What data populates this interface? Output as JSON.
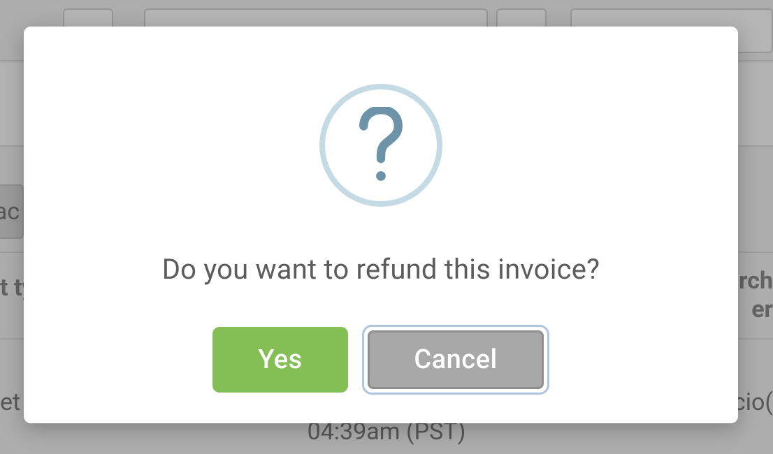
{
  "background": {
    "tab_fragment": "ac",
    "col_left_fragment": "t ty",
    "col_right_fragment_line1": "urch",
    "col_right_fragment_line2": "er",
    "row_left_fragment": "et",
    "row_mid_fragment": "04:39am (PST)",
    "row_right_fragment": "ecio("
  },
  "dialog": {
    "icon": "question-icon",
    "title": "Do you want to refund this invoice?",
    "confirm_label": "Yes",
    "cancel_label": "Cancel"
  }
}
